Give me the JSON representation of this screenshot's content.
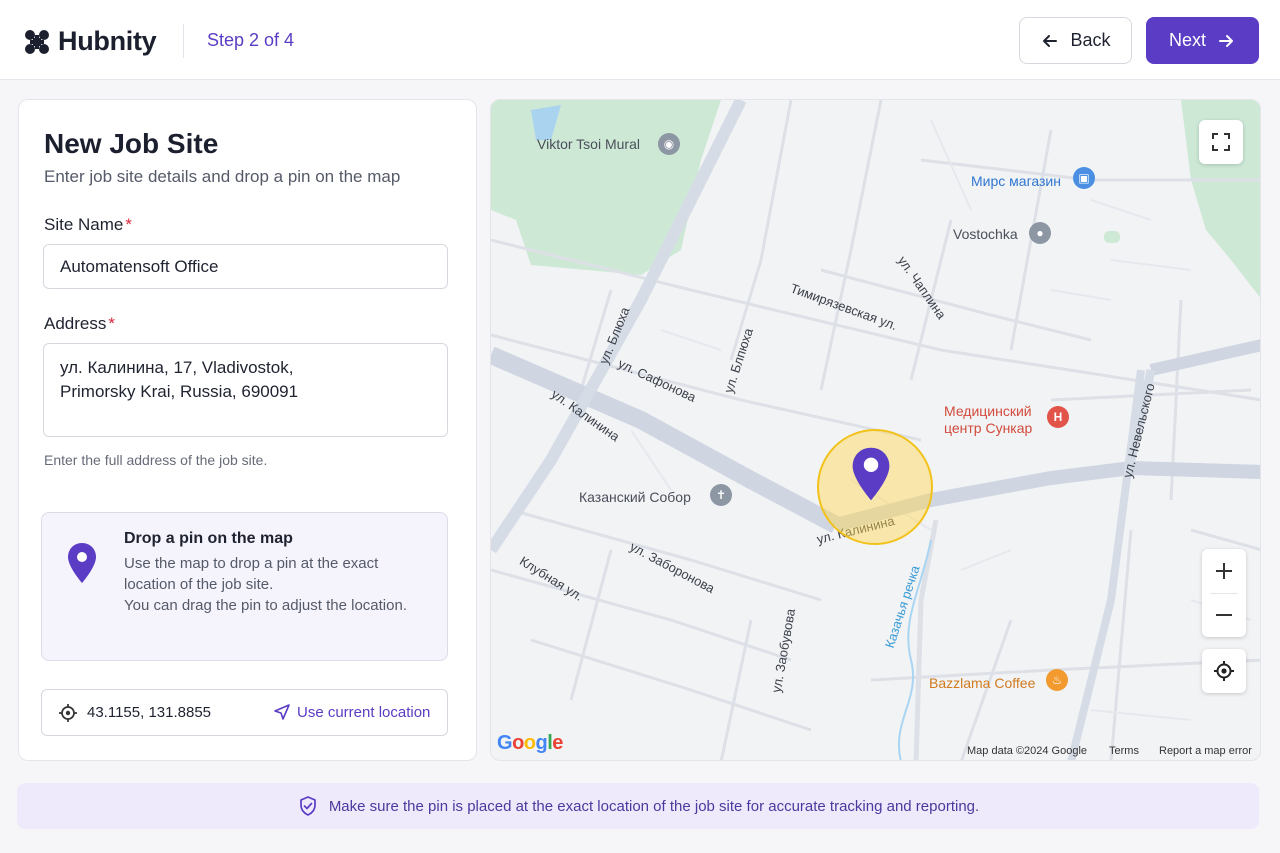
{
  "header": {
    "logo_text": "Hubnity",
    "step": "Step 2 of 4",
    "back_label": "Back",
    "next_label": "Next",
    "accent_color": "#5b3cc4"
  },
  "form": {
    "title": "New Job Site",
    "subtitle": "Enter job site details and drop a pin on the map",
    "site_name_label": "Site Name",
    "site_name_value": "Automatensoft Office",
    "address_label": "Address",
    "address_line1": "ул. Калинина, 17, Vladivostok,",
    "address_line2": "Primorsky Krai, Russia, 690091",
    "required_mark": "*",
    "address_hint": "Enter the full address of the job site.",
    "pin_title": "Drop a pin on the map",
    "pin_desc_1": "Use the map to drop a pin at the exact location of the job site.",
    "pin_desc_2": "You can drag the pin to adjust the location.",
    "coordinates": "43.1155, 131.8855",
    "use_current_location": "Use current location"
  },
  "map": {
    "places": {
      "tsoi": "Viktor Tsoi Mural",
      "mirs": "Мирс магазин",
      "vostochka": "Vostochka",
      "med1": "Медицинский",
      "med2": "центр Сункар",
      "sobor": "Казанский Собор",
      "coffee": "Bazzlama Coffee"
    },
    "streets": {
      "timir": "Тимирязевская ул.",
      "chaplina": "ул. Чаплина",
      "blyukhera1": "ул. Блюха",
      "blyukhera2": "ул. Блпюха",
      "safonova": "ул. Сафонова",
      "kalinina1": "ул. Калинина",
      "kalinina2": "ул. Калинина",
      "nevelskogo": "ул. Невельского",
      "zaborova": "ул. Заборонова",
      "klubnaya": "Клубная ул.",
      "zaobyvova": "ул. Заобувова",
      "kazachya": "Казачья речка"
    },
    "attribution": "Map data ©2024 Google",
    "terms": "Terms",
    "report": "Report a map error",
    "google": [
      "G",
      "o",
      "o",
      "g",
      "l",
      "e"
    ]
  },
  "banner": {
    "text": "Make sure the pin is placed at the exact location of the job site for accurate tracking and reporting."
  }
}
